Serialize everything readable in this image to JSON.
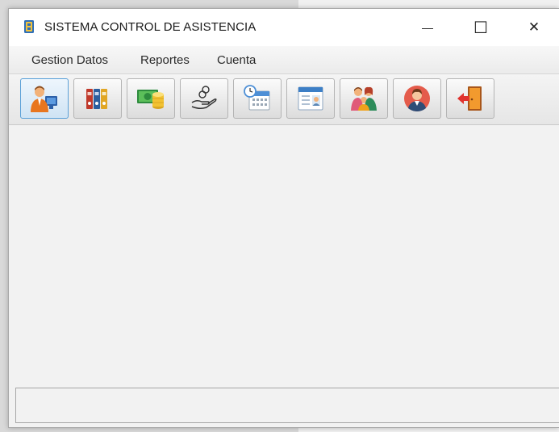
{
  "window": {
    "title": "SISTEMA CONTROL DE ASISTENCIA",
    "controls": {
      "minimize": "—",
      "maximize": "☐",
      "close": "✕"
    }
  },
  "menubar": {
    "items": [
      {
        "label": "Gestion Datos"
      },
      {
        "label": "Reportes"
      },
      {
        "label": "Cuenta"
      }
    ]
  },
  "toolbar": {
    "buttons": [
      {
        "icon": "employee-computer-icon",
        "selected": true
      },
      {
        "icon": "binders-icon",
        "selected": false
      },
      {
        "icon": "money-coins-icon",
        "selected": false
      },
      {
        "icon": "hand-coins-icon",
        "selected": false
      },
      {
        "icon": "calendar-clock-icon",
        "selected": false
      },
      {
        "icon": "id-card-form-icon",
        "selected": false
      },
      {
        "icon": "family-group-icon",
        "selected": false
      },
      {
        "icon": "user-avatar-icon",
        "selected": false
      },
      {
        "icon": "exit-door-icon",
        "selected": false
      }
    ]
  },
  "status": {
    "text": ""
  }
}
